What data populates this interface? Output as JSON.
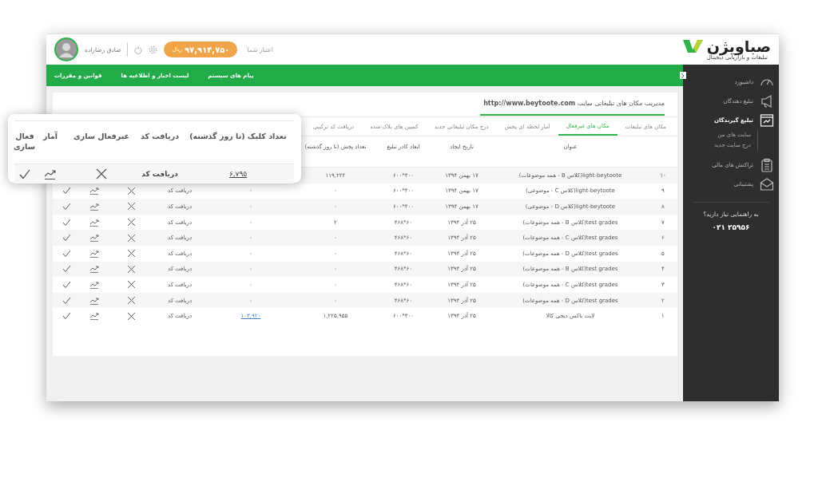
{
  "header": {
    "logo": "صباویژن",
    "tagline": "تبلیغات و بازاریابی دیجیتال",
    "credit_label": "اعتبار شما",
    "credit": "۹۷,۹۱۴,۷۵۰",
    "currency": "ریال",
    "user_name": "صادق رضازاده"
  },
  "nav": [
    "پیام های سیستم",
    "لیست اخبار و اطلاعیه ها",
    "قوانین و مقررات"
  ],
  "sidebar": {
    "items": [
      {
        "label": "داشبورد",
        "kind": "gauge",
        "selected": false
      },
      {
        "label": "تبلیغ دهندگان",
        "kind": "megaphone",
        "selected": false
      },
      {
        "label": "تبلیغ گیرندگان",
        "kind": "window",
        "selected": true,
        "children": [
          {
            "label": "سایت های من",
            "selected": false
          },
          {
            "label": "درج سایت جدید",
            "selected": false
          }
        ]
      },
      {
        "label": "تراکنش های مالی",
        "kind": "clipboard",
        "selected": false
      },
      {
        "label": "پشتیبانی",
        "kind": "envelope",
        "selected": false
      }
    ],
    "help": "به راهنمایی نیاز دارید؟",
    "phone": "۰۲۱ ۲۵۹۵۶"
  },
  "page_title": "مدیریت مکان های تبلیغاتی سایت **http://www.beytoote.com**",
  "tabs": [
    {
      "label": "مکان های تبلیغات",
      "selected": false
    },
    {
      "label": "مکان های غیرفعال",
      "selected": true
    },
    {
      "label": "آمار لحظه ای پخش",
      "selected": false
    },
    {
      "label": "درج مکان تبلیغاتی جدید",
      "selected": false
    },
    {
      "label": "کمپین های بلاک شده",
      "selected": false
    },
    {
      "label": "دریافت کد ترکیبی",
      "selected": false
    }
  ],
  "table": {
    "columns": [
      "عنوان",
      "تاریخ ایجاد",
      "ابعاد کادر تبلیغ",
      "تعداد پخش (تا روز گذشته)"
    ],
    "rows": [
      {
        "number": "۱۰",
        "title": "light-beytoote(کلاس B - همه موضوعات)",
        "date": "۱۷ بهمن ۱۳۹۴",
        "size": "۶۰۰*۴۰۰",
        "impressions": "۱۱۹,۲۲۲"
      },
      {
        "number": "۹",
        "title": "light-beytoote(کلاس C - موضوعی)",
        "date": "۱۷ بهمن ۱۳۹۴",
        "size": "۶۰۰*۴۰۰",
        "impressions": "۰",
        "clicks": "۰",
        "clicks_link": false,
        "code": "دریافت کد"
      },
      {
        "number": "۸",
        "title": "light-beytoote(کلاس D - موضوعی)",
        "date": "۱۷ بهمن ۱۳۹۴",
        "size": "۶۰۰*۴۰۰",
        "impressions": "۰",
        "clicks": "۰",
        "clicks_link": false,
        "code": "دریافت کد"
      },
      {
        "number": "۷",
        "title": "test grades(کلاس B - همه موضوعات)",
        "date": "۲۵ آذر ۱۳۹۴",
        "size": "۴۶۸*۶۰",
        "impressions": "۲",
        "clicks": "۰",
        "clicks_link": false,
        "code": "دریافت کد"
      },
      {
        "number": "۶",
        "title": "test grades(کلاس C - همه موضوعات)",
        "date": "۲۵ آذر ۱۳۹۴",
        "size": "۴۶۸*۶۰",
        "impressions": "۰",
        "clicks": "۰",
        "clicks_link": false,
        "code": "دریافت کد"
      },
      {
        "number": "۵",
        "title": "test grades(کلاس D - همه موضوعات)",
        "date": "۲۵ آذر ۱۳۹۴",
        "size": "۴۶۸*۶۰",
        "impressions": "۰",
        "clicks": "۰",
        "clicks_link": false,
        "code": "دریافت کد"
      },
      {
        "number": "۴",
        "title": "test grades(کلاس B - همه موضوعات)",
        "date": "۲۵ آذر ۱۳۹۴",
        "size": "۴۶۸*۶۰",
        "impressions": "۰",
        "clicks": "۰",
        "clicks_link": false,
        "code": "دریافت کد"
      },
      {
        "number": "۳",
        "title": "test grades(کلاس C - همه موضوعات)",
        "date": "۲۵ آذر ۱۳۹۴",
        "size": "۴۶۸*۶۰",
        "impressions": "۰",
        "clicks": "۰",
        "clicks_link": false,
        "code": "دریافت کد"
      },
      {
        "number": "۲",
        "title": "test grades(کلاس D - همه موضوعات)",
        "date": "۲۵ آذر ۱۳۹۴",
        "size": "۴۶۸*۶۰",
        "impressions": "۰",
        "clicks": "۰",
        "clicks_link": false,
        "code": "دریافت کد"
      },
      {
        "number": "۱",
        "title": "لایت باکس دیجی کالا",
        "date": "۲۵ آذر ۱۳۹۴",
        "size": "۶۰۰*۴۰۰",
        "impressions": "۱,۲۲۵,۹۵۵",
        "clicks": "۱۰۳,۹۲۰",
        "clicks_link": true,
        "code": "دریافت کد"
      }
    ]
  },
  "zoom_card": {
    "columns": [
      "تعداد کلیک (تا روز گذشته)",
      "دریافت کد",
      "غیرفعال سازی",
      "آمار",
      "فعال سازی"
    ],
    "row": {
      "clicks": "۶,۷۹۵",
      "clicks_link": true,
      "code": "دریافت کد"
    }
  }
}
